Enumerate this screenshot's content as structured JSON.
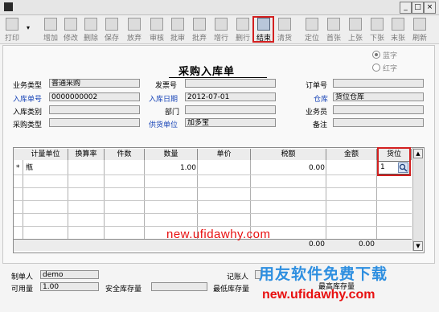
{
  "window": {
    "minimize": "_",
    "maximize": "□",
    "close": "×"
  },
  "toolbar": [
    {
      "label": "打印",
      "icon": "printer-icon"
    },
    {
      "label": "增加",
      "icon": "add-icon"
    },
    {
      "label": "修改",
      "icon": "edit-icon"
    },
    {
      "label": "删除",
      "icon": "delete-icon"
    },
    {
      "label": "保存",
      "icon": "save-icon"
    },
    {
      "label": "放弃",
      "icon": "discard-icon"
    },
    {
      "label": "审核",
      "icon": "audit-icon"
    },
    {
      "label": "批审",
      "icon": "batch-audit-icon"
    },
    {
      "label": "批弃",
      "icon": "batch-discard-icon"
    },
    {
      "label": "增行",
      "icon": "add-row-icon"
    },
    {
      "label": "删行",
      "icon": "delete-row-icon"
    },
    {
      "label": "结束",
      "icon": "finish-icon",
      "active": true
    },
    {
      "label": "清货",
      "icon": "clear-icon"
    },
    {
      "label": "定位",
      "icon": "locate-icon"
    },
    {
      "label": "首张",
      "icon": "first-icon"
    },
    {
      "label": "上张",
      "icon": "prev-icon"
    },
    {
      "label": "下张",
      "icon": "next-icon"
    },
    {
      "label": "末张",
      "icon": "last-icon"
    },
    {
      "label": "刷新",
      "icon": "refresh-icon"
    }
  ],
  "form": {
    "title": "采购入库单",
    "radio_blue": "蓝字",
    "radio_red": "红字",
    "labels": {
      "biz_type": "业务类型",
      "receipt_no": "入库单号",
      "receipt_category": "入库类别",
      "purchase_type": "采购类型",
      "invoice_no": "发票号",
      "receipt_date": "入库日期",
      "department": "部门",
      "supplier": "供货单位",
      "order_no": "订单号",
      "warehouse": "仓库",
      "salesman": "业务员",
      "remark": "备注"
    },
    "values": {
      "biz_type": "普通采购",
      "receipt_no": "0000000002",
      "receipt_category": "",
      "purchase_type": "",
      "invoice_no": "",
      "receipt_date": "2012-07-01",
      "department": "",
      "supplier": "加多宝",
      "order_no": "",
      "warehouse": "货位仓库",
      "salesman": "",
      "remark": ""
    }
  },
  "grid": {
    "columns": [
      "计量单位",
      "换算率",
      "件数",
      "数量",
      "单价",
      "税额",
      "金额",
      "货位"
    ],
    "rows": [
      {
        "marker": "*",
        "unit": "瓶",
        "rate": "",
        "pieces": "",
        "qty": "1.00",
        "price": "",
        "tax": "0.00",
        "amount": "",
        "location": "1"
      }
    ],
    "totals": {
      "tax": "0.00",
      "amount": "0.00"
    }
  },
  "footer": {
    "maker_label": "制单人",
    "maker_value": "demo",
    "bookkeeper_label": "记账人",
    "available_label": "可用量",
    "available_value": "1.00",
    "safety_label": "安全库存量",
    "min_label": "最低库存量",
    "max_label": "最高库存量"
  },
  "watermarks": {
    "url_center": "new.ufidawhy.com",
    "brand": "用友软件免费下载",
    "url_bottom": "new.ufidawhy.com"
  }
}
